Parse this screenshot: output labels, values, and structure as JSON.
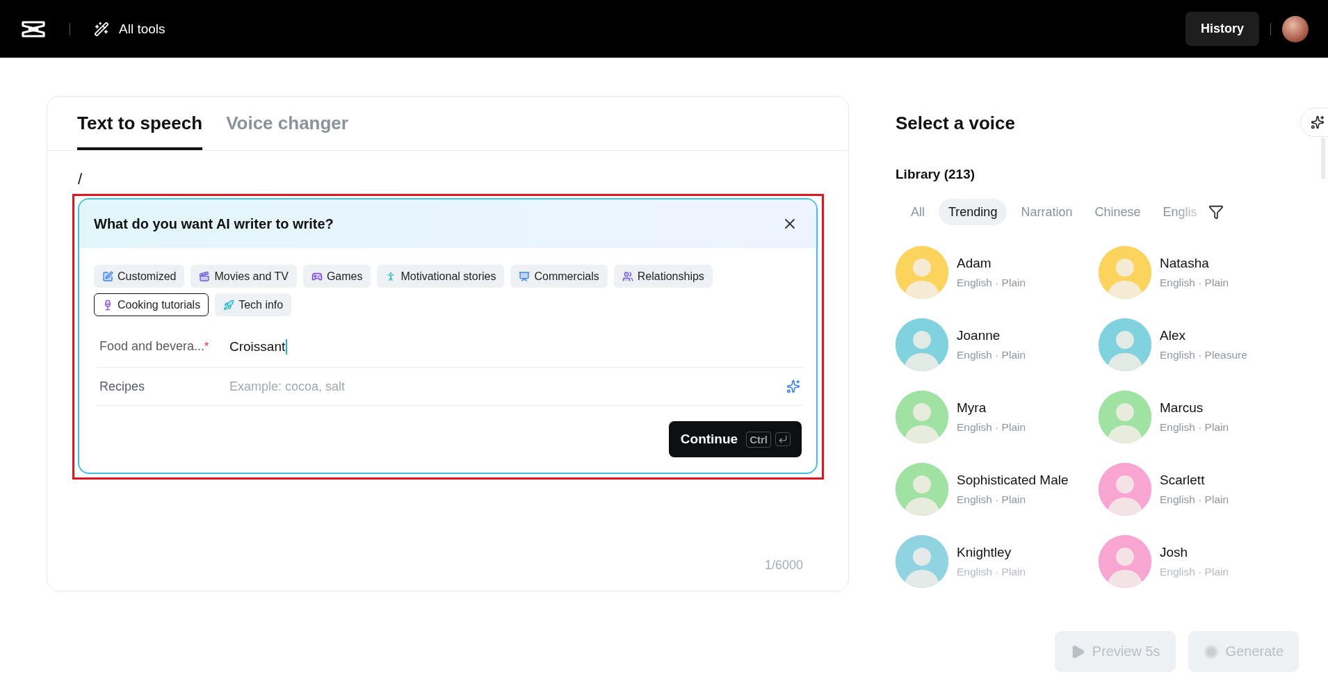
{
  "header": {
    "nav_label": "All tools",
    "history_button": "History"
  },
  "tabs": [
    {
      "label": "Text to speech",
      "selected": true
    },
    {
      "label": "Voice changer",
      "selected": false
    }
  ],
  "editor": {
    "value": "/",
    "counter": "1/6000"
  },
  "ai_writer": {
    "title": "What do you want AI writer to write?",
    "categories": [
      {
        "label": "Customized",
        "selected": false
      },
      {
        "label": "Movies and TV",
        "selected": false
      },
      {
        "label": "Games",
        "selected": false
      },
      {
        "label": "Motivational stories",
        "selected": false
      },
      {
        "label": "Commercials",
        "selected": false
      },
      {
        "label": "Relationships",
        "selected": false
      },
      {
        "label": "Cooking tutorials",
        "selected": true
      },
      {
        "label": "Tech info",
        "selected": false
      }
    ],
    "fields": [
      {
        "kind": "required",
        "label": "Food and bevera...",
        "required_mark": "*",
        "value": "Croissant"
      },
      {
        "kind": "suggest",
        "label": "Recipes",
        "placeholder": "Example: cocoa, salt"
      }
    ],
    "continue_button": {
      "label": "Continue",
      "shortcut": "Ctrl"
    }
  },
  "voice_panel": {
    "title": "Select a voice",
    "library_title": "Library (213)",
    "filters": [
      {
        "label": "All",
        "selected": false
      },
      {
        "label": "Trending",
        "selected": true
      },
      {
        "label": "Narration",
        "selected": false
      },
      {
        "label": "Chinese",
        "selected": false
      },
      {
        "label": "Englis",
        "selected": false
      }
    ],
    "voices": [
      {
        "name": "Adam",
        "details": "English · Plain",
        "color": "#fcd35c"
      },
      {
        "name": "Natasha",
        "details": "English · Plain",
        "color": "#fcd35c"
      },
      {
        "name": "Joanne",
        "details": "English · Plain",
        "color": "#80d3de"
      },
      {
        "name": "Alex",
        "details": "English · Pleasure",
        "color": "#80d3de"
      },
      {
        "name": "Myra",
        "details": "English · Plain",
        "color": "#9fe2a2"
      },
      {
        "name": "Marcus",
        "details": "English · Plain",
        "color": "#9fe2a2"
      },
      {
        "name": "Sophisticated Male",
        "details": "English · Plain",
        "color": "#9fe2a2"
      },
      {
        "name": "Scarlett",
        "details": "English · Plain",
        "color": "#f8a5d2"
      },
      {
        "name": "Knightley",
        "details": "English · Plain",
        "color": "#8fd4e0"
      },
      {
        "name": "Josh",
        "details": "English · Plain",
        "color": "#f8a5d2"
      }
    ]
  },
  "actions": [
    {
      "kind": "preview",
      "label": "Preview 5s",
      "disabled": true
    },
    {
      "kind": "generate",
      "label": "Generate",
      "disabled": true
    }
  ]
}
